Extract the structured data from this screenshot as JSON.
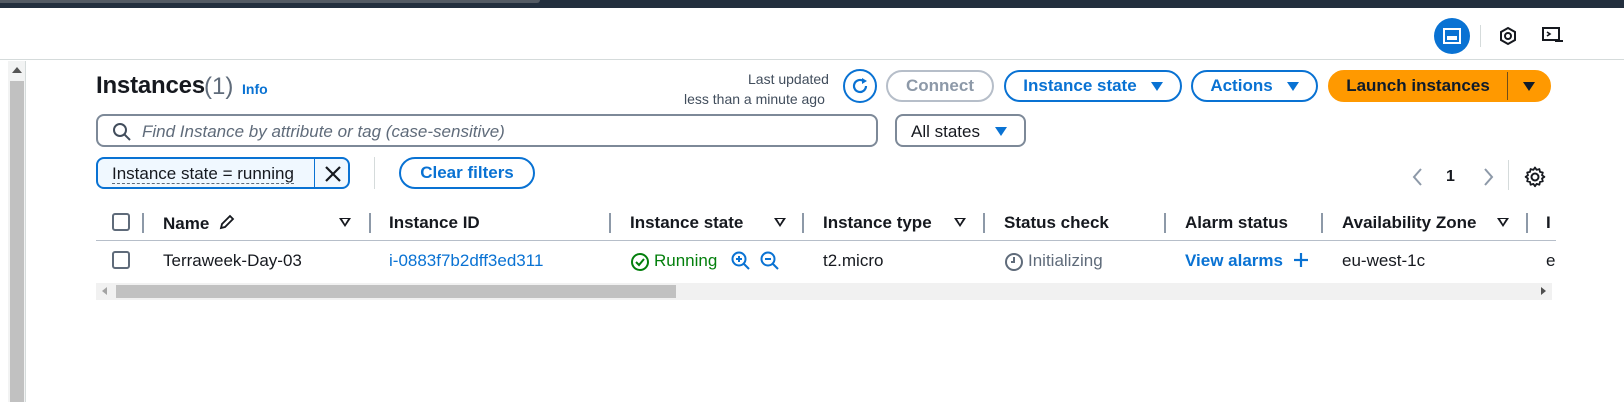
{
  "header": {
    "title": "Instances",
    "count": "(1)",
    "info_label": "Info",
    "last_updated_line1": "Last updated",
    "last_updated_line2": "less than a minute ago"
  },
  "toolbar": {
    "connect_label": "Connect",
    "instance_state_label": "Instance state",
    "actions_label": "Actions",
    "launch_label": "Launch instances"
  },
  "search": {
    "placeholder": "Find Instance by attribute or tag (case-sensitive)",
    "state_filter_value": "All states"
  },
  "filters": {
    "token_label": "Instance state = running",
    "clear_label": "Clear filters"
  },
  "pagination": {
    "current_page": "1"
  },
  "table": {
    "columns": [
      "Name",
      "Instance ID",
      "Instance state",
      "Instance type",
      "Status check",
      "Alarm status",
      "Availability Zone",
      "I"
    ],
    "rows": [
      {
        "name": "Terraweek-Day-03",
        "instance_id": "i-0883f7b2dff3ed311",
        "instance_state": "Running",
        "instance_type": "t2.micro",
        "status_check": "Initializing",
        "alarm_status": "View alarms",
        "availability_zone": "eu-west-1c",
        "truncated_next": "e"
      }
    ]
  },
  "colors": {
    "primary_blue": "#0972d3",
    "launch_orange": "#ff9900",
    "running_green": "#037f0c",
    "top_bar": "#232f3e"
  },
  "icons": [
    "refresh-icon",
    "search-icon",
    "close-icon",
    "edit-pencil-icon",
    "check-circle-icon",
    "zoom-in-icon",
    "zoom-out-icon",
    "clock-icon",
    "plus-icon",
    "gear-icon",
    "chevron-left-icon",
    "chevron-right-icon"
  ]
}
